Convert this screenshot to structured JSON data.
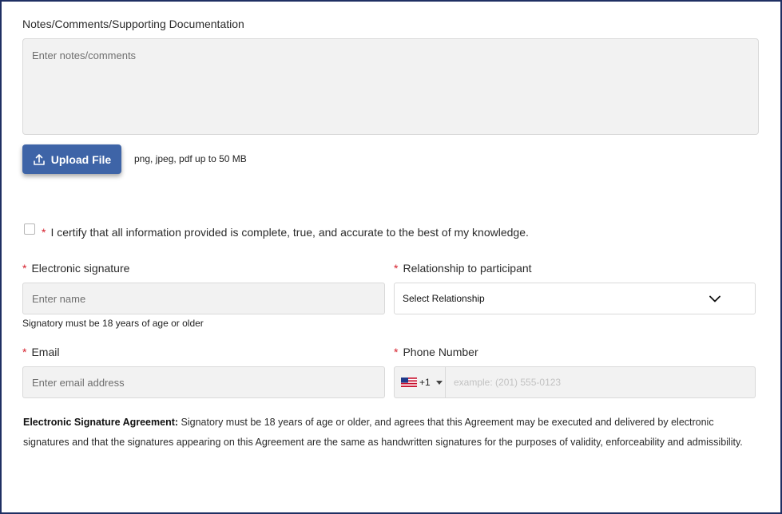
{
  "notes": {
    "label": "Notes/Comments/Supporting Documentation",
    "placeholder": "Enter notes/comments"
  },
  "upload": {
    "button_label": "Upload File",
    "hint": "png, jpeg, pdf up to 50 MB"
  },
  "certify": {
    "required_mark": "*",
    "text": "I certify that all information provided is complete, true, and accurate to the best of my knowledge."
  },
  "signature": {
    "required_mark": "*",
    "label": "Electronic signature",
    "placeholder": "Enter name",
    "helper": "Signatory must be 18 years of age or older"
  },
  "relationship": {
    "required_mark": "*",
    "label": "Relationship to participant",
    "selected": "Select Relationship"
  },
  "email": {
    "required_mark": "*",
    "label": "Email",
    "placeholder": "Enter email address"
  },
  "phone": {
    "required_mark": "*",
    "label": "Phone Number",
    "country_code": "+1",
    "placeholder": "example: (201) 555-0123"
  },
  "agreement": {
    "title": "Electronic Signature Agreement:",
    "text": "Signatory must be 18 years of age or older, and agrees that this Agreement may be executed and delivered by electronic signatures and that the signatures appearing on this Agreement are the same as handwritten signatures for the purposes of validity, enforceability and admissibility."
  },
  "colors": {
    "primary_button": "#3e64a7",
    "required": "#d61f2c",
    "input_bg": "#f2f2f2",
    "frame_border": "#1f2f63"
  },
  "icons": {
    "upload": "upload-icon",
    "dropdown": "chevron-down-icon",
    "country_flag": "us-flag-icon",
    "country_dropdown": "caret-down-icon"
  }
}
